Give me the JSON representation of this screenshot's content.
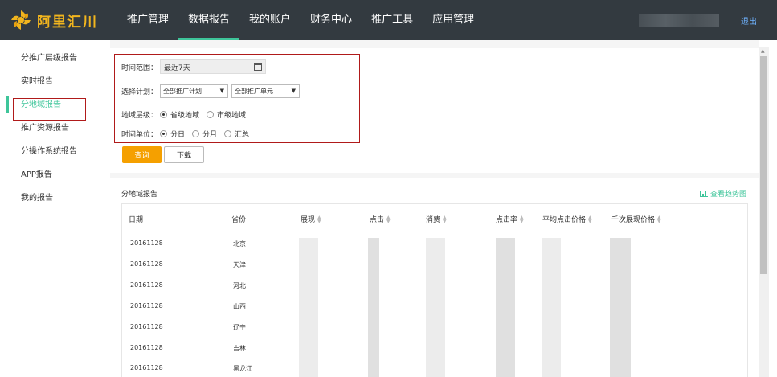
{
  "header": {
    "logo_text": "阿里汇川",
    "nav": [
      "推广管理",
      "数据报告",
      "我的账户",
      "财务中心",
      "推广工具",
      "应用管理"
    ],
    "active_nav": 1,
    "logout": "退出"
  },
  "sidebar": {
    "items": [
      "分推广层级报告",
      "实时报告",
      "分地域报告",
      "推广资源报告",
      "分操作系统报告",
      "APP报告",
      "我的报告"
    ],
    "active": 2
  },
  "filters": {
    "time_range_label": "时间范围：",
    "time_range_value": "最近7天",
    "plan_label": "选择计划：",
    "plan_select": "全部推广计划",
    "unit_select": "全部推广单元",
    "region_level_label": "地域层级：",
    "region_options": [
      "省级地域",
      "市级地域"
    ],
    "region_selected": 0,
    "time_unit_label": "时间单位：",
    "time_unit_options": [
      "分日",
      "分月",
      "汇总"
    ],
    "time_unit_selected": 0
  },
  "buttons": {
    "query": "查询",
    "download": "下载"
  },
  "report": {
    "title": "分地域报告",
    "trend_link": "查看趋势图",
    "columns": [
      "日期",
      "省份",
      "展现",
      "点击",
      "消费",
      "点击率",
      "平均点击价格",
      "千次展现价格"
    ],
    "rows": [
      {
        "date": "20161128",
        "province": "北京"
      },
      {
        "date": "20161128",
        "province": "天津"
      },
      {
        "date": "20161128",
        "province": "河北"
      },
      {
        "date": "20161128",
        "province": "山西"
      },
      {
        "date": "20161128",
        "province": "辽宁"
      },
      {
        "date": "20161128",
        "province": "吉林"
      },
      {
        "date": "20161128",
        "province": "黑龙江"
      }
    ]
  }
}
